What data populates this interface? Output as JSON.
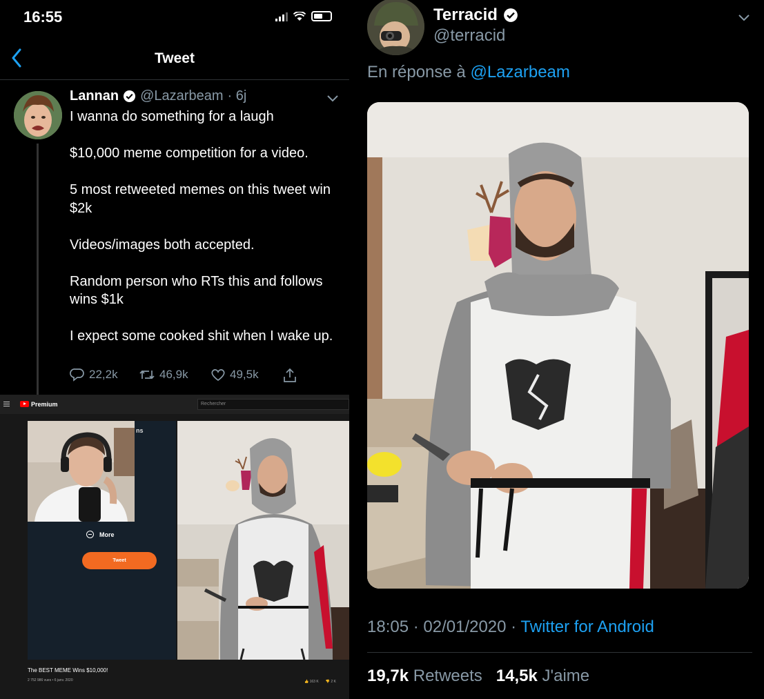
{
  "left": {
    "status_bar": {
      "time": "16:55"
    },
    "nav": {
      "title": "Tweet"
    },
    "tweet": {
      "author_name": "Lannan",
      "handle": "@Lazarbeam",
      "age": "· 6j",
      "text": "I wanna do something for a laugh\n\n$10,000 meme competition for a video.\n\n5 most retweeted memes on this tweet win $2k\n\nVideos/images both accepted.\n\nRandom person who RTs this and follows wins $1k\n\nI expect some cooked shit when I wake up.",
      "replies": "22,2k",
      "retweets": "46,9k",
      "likes": "49,5k"
    },
    "youtube": {
      "brand": "Premium",
      "search_placeholder": "Rechercher",
      "sidebar_fragment": "ns",
      "more_label": "More",
      "tweet_button": "Tweet",
      "video_title": "The BEST MEME Wins $10,000!",
      "video_meta": "2 752 986 vues • 6 janv. 2020",
      "likes": "163 K",
      "dislikes": "2 K"
    }
  },
  "right": {
    "author_name": "Terracid",
    "handle": "@terracid",
    "reply_prefix": "En réponse à",
    "reply_handle": "@Lazarbeam",
    "timestamp": "18:05 · 02/01/2020 ·",
    "client": "Twitter for Android",
    "retweet_count": "19,7k",
    "retweet_label": "Retweets",
    "like_count": "14,5k",
    "like_label": "J'aime"
  },
  "colors": {
    "background": "#000000",
    "link": "#1da1f2",
    "secondary_text": "#8899a6",
    "verified": "#ffffff",
    "youtube_accent": "#f26a21"
  }
}
